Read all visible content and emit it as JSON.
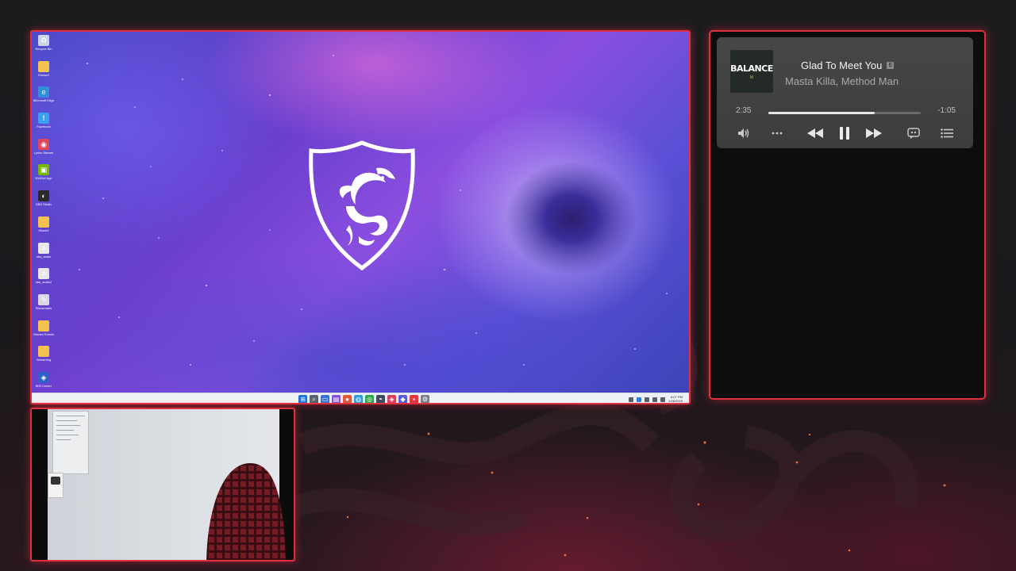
{
  "desktop": {
    "icons": [
      {
        "name": "recycle-bin-icon",
        "label": "Recycle Bin",
        "color": "#c9d4e6",
        "glyph": "♻"
      },
      {
        "name": "folder-icon",
        "label": "Entwurf",
        "color": "#f2c14e",
        "glyph": ""
      },
      {
        "name": "edge-icon",
        "label": "Microsoft Edge",
        "color": "#2f8fd8",
        "glyph": "e"
      },
      {
        "name": "app-icon",
        "label": "Facebook",
        "color": "#3aa0f0",
        "glyph": "f"
      },
      {
        "name": "app-icon",
        "label": "Lyrics Stream",
        "color": "#e0475c",
        "glyph": "◉"
      },
      {
        "name": "nvidia-icon",
        "label": "NVIDIA App",
        "color": "#76b900",
        "glyph": "▣"
      },
      {
        "name": "obs-icon",
        "label": "OBS Studio",
        "color": "#2a2a2a",
        "glyph": "◐"
      },
      {
        "name": "folder-icon",
        "label": "ShareX",
        "color": "#f2c14e",
        "glyph": ""
      },
      {
        "name": "file-icon",
        "label": "obs_audio",
        "color": "#e8e8e8",
        "glyph": "≡"
      },
      {
        "name": "file-icon",
        "label": "obs_audio2",
        "color": "#e8e8e8",
        "glyph": "≡"
      },
      {
        "name": "app-icon",
        "label": "Streamlabs",
        "color": "#d8d8e8",
        "glyph": "✎"
      },
      {
        "name": "folder-icon",
        "label": "Stream Events",
        "color": "#f2c14e",
        "glyph": ""
      },
      {
        "name": "folder-icon",
        "label": "Streaming",
        "color": "#f2c14e",
        "glyph": ""
      },
      {
        "name": "app-icon",
        "label": "MSI Center",
        "color": "#3060c8",
        "glyph": "◈"
      }
    ],
    "taskbar": {
      "apps": [
        {
          "name": "start-icon",
          "color": "#1e6fd9",
          "glyph": "⊞"
        },
        {
          "name": "search-icon",
          "color": "#5a6270",
          "glyph": "⌕"
        },
        {
          "name": "file-explorer-icon",
          "color": "#3b6fd0",
          "glyph": "▭"
        },
        {
          "name": "app-icon",
          "color": "#8a4fd8",
          "glyph": "▤"
        },
        {
          "name": "app-icon",
          "color": "#e05a3a",
          "glyph": "●"
        },
        {
          "name": "app-icon",
          "color": "#2d9be0",
          "glyph": "◍"
        },
        {
          "name": "app-icon",
          "color": "#2aa84a",
          "glyph": "◎"
        },
        {
          "name": "app-icon",
          "color": "#404a5a",
          "glyph": "◓"
        },
        {
          "name": "app-icon",
          "color": "#d8405a",
          "glyph": "◈"
        },
        {
          "name": "app-icon",
          "color": "#5c5cd8",
          "glyph": "◆"
        },
        {
          "name": "app-icon",
          "color": "#e23a3a",
          "glyph": "▪"
        },
        {
          "name": "settings-icon",
          "color": "#7a7f88",
          "glyph": "⚙"
        }
      ],
      "time": "6:07 PM",
      "date": "1/26/2025"
    }
  },
  "music": {
    "album_title": "BALANCE",
    "album_subtitle": "M",
    "track_title": "Glad To Meet You",
    "artist": "Masta Killa, Method Man",
    "elapsed": "2:35",
    "remaining": "-1:05",
    "progress": 0.7
  },
  "colors": {
    "accent": "#e0303f",
    "panel": "#454547"
  }
}
